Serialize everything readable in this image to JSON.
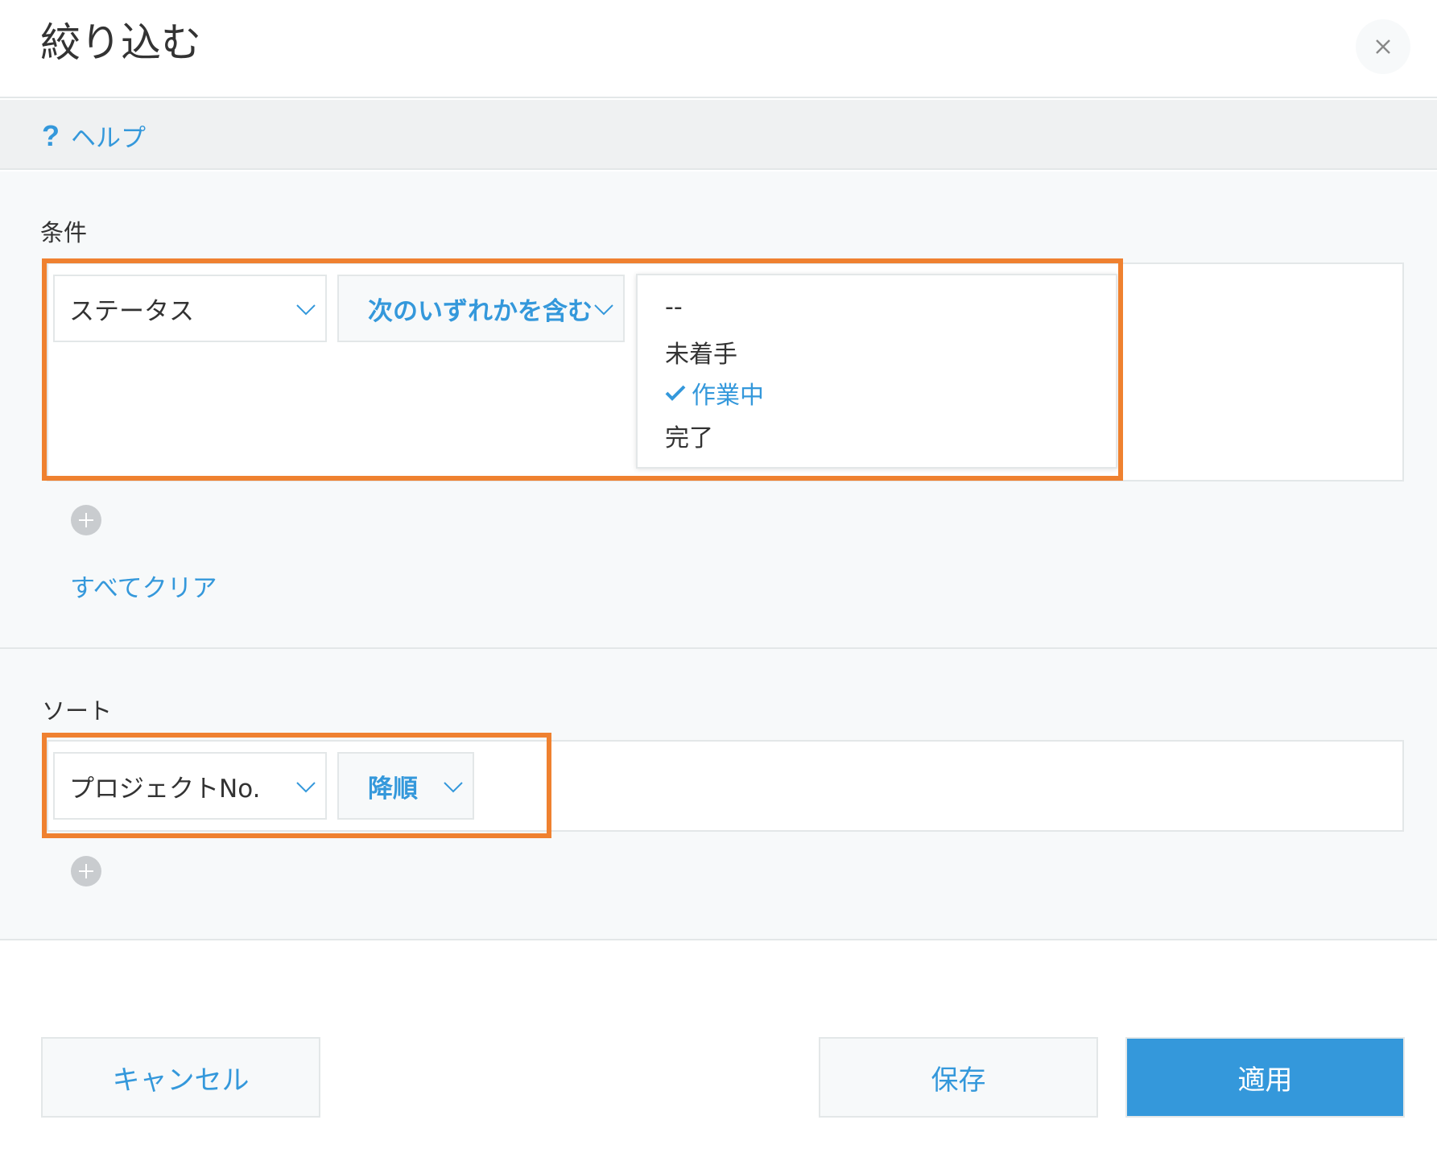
{
  "dialog": {
    "title": "絞り込む",
    "close_label": "×"
  },
  "help": {
    "icon": "question-icon",
    "icon_glyph": "?",
    "label": "ヘルプ"
  },
  "conditions": {
    "label": "条件",
    "field_select": "ステータス",
    "operator_select": "次のいずれかを含む",
    "options": [
      {
        "label": "--",
        "selected": false
      },
      {
        "label": "未着手",
        "selected": false
      },
      {
        "label": "作業中",
        "selected": true
      },
      {
        "label": "完了",
        "selected": false
      }
    ],
    "clear_all": "すべてクリア"
  },
  "sort": {
    "label": "ソート",
    "field_select": "プロジェクトNo.",
    "order_select": "降順"
  },
  "footer": {
    "cancel": "キャンセル",
    "save": "保存",
    "apply": "適用"
  },
  "colors": {
    "accent": "#3498db",
    "highlight": "#ef8130",
    "panel_bg": "#f7f9fa",
    "border": "#e3e7e8"
  }
}
